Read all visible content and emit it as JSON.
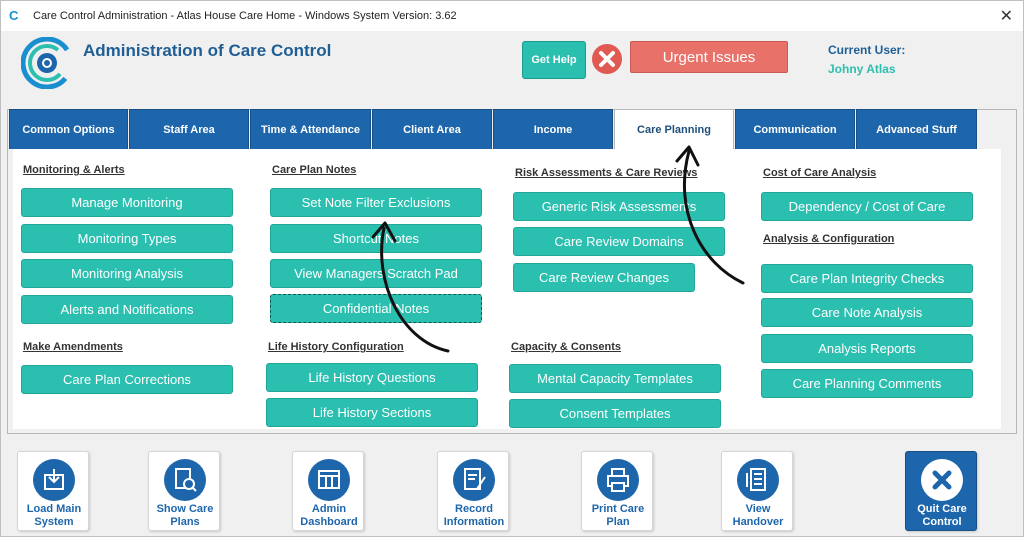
{
  "window": {
    "title": "Care Control Administration - Atlas House Care Home - Windows System Version: 3.62",
    "close_symbol": "✕",
    "app_icon": "C"
  },
  "header": {
    "heading": "Administration of Care Control",
    "get_help": "Get Help",
    "urgent": "Urgent Issues",
    "current_user_label": "Current User:",
    "current_user": "Johny Atlas"
  },
  "tabs": [
    "Common Options",
    "Staff Area",
    "Time & Attendance",
    "Client Area",
    "Income",
    "Care Planning",
    "Communication",
    "Advanced Stuff"
  ],
  "sections": {
    "monitoring": {
      "title": "Monitoring & Alerts",
      "buttons": [
        "Manage Monitoring",
        "Monitoring Types",
        "Monitoring Analysis",
        "Alerts and Notifications"
      ]
    },
    "amendments": {
      "title": "Make Amendments",
      "buttons": [
        "Care Plan Corrections"
      ]
    },
    "notes": {
      "title": "Care Plan Notes",
      "buttons": [
        "Set Note Filter Exclusions",
        "Shortcut Notes",
        "View Managers Scratch Pad",
        "Confidential Notes"
      ]
    },
    "life_history": {
      "title": "Life History Configuration",
      "buttons": [
        "Life History Questions",
        "Life History Sections"
      ]
    },
    "risk": {
      "title": "Risk Assessments & Care Reviews",
      "buttons": [
        "Generic Risk Assessments",
        "Care Review Domains",
        "Care Review Changes"
      ]
    },
    "capacity": {
      "title": "Capacity & Consents",
      "buttons": [
        "Mental Capacity Templates",
        "Consent Templates"
      ]
    },
    "cost": {
      "title": "Cost of Care Analysis",
      "buttons": [
        "Dependency / Cost of Care"
      ]
    },
    "analysis": {
      "title": "Analysis & Configuration",
      "buttons": [
        "Care Plan Integrity Checks",
        "Care Note Analysis",
        "Analysis Reports",
        "Care Planning Comments"
      ]
    }
  },
  "footer": [
    {
      "line1": "Load Main",
      "line2": "System"
    },
    {
      "line1": "Show Care",
      "line2": "Plans"
    },
    {
      "line1": "Admin",
      "line2": "Dashboard"
    },
    {
      "line1": "Record",
      "line2": "Information"
    },
    {
      "line1": "Print Care",
      "line2": "Plan"
    },
    {
      "line1": "View",
      "line2": "Handover"
    },
    {
      "line1": "Quit Care",
      "line2": "Control"
    }
  ],
  "colors": {
    "teal": "#2bbfb0",
    "navy": "#1e66ac",
    "urgent": "#e8716a"
  }
}
